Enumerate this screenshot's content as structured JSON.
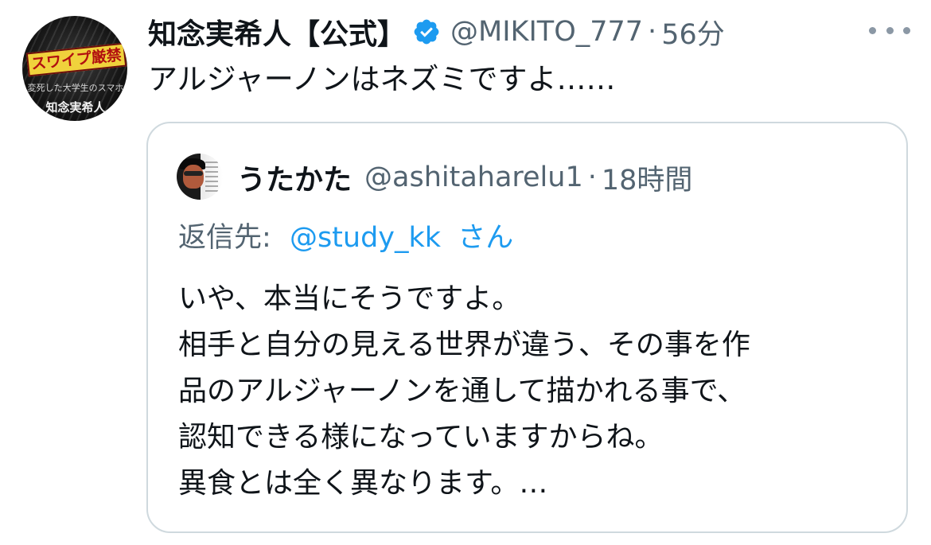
{
  "tweet": {
    "author": {
      "display_name": "知念実希人【公式】",
      "handle": "@MIKITO_777",
      "verified": true,
      "avatar": {
        "banner_text": "スワイプ厳禁",
        "sub_text": "変死した大学生のスマホ",
        "name_text": "知念実希人"
      }
    },
    "separator": "·",
    "time": "56分",
    "text": "アルジャーノンはネズミですよ……",
    "more_icon": "more-horizontal-icon"
  },
  "quoted": {
    "author": {
      "display_name": "うたかた",
      "handle": "@ashitaharelu1"
    },
    "separator": "·",
    "time": "18時間",
    "reply_to": {
      "label": "返信先:",
      "handle": "@study_kk",
      "suffix": "さん"
    },
    "lines": [
      "いや、本当にそうですよ。",
      "相手と自分の見える世界が違う、その事を作",
      "品のアルジャーノンを通して描かれる事で、",
      "認知できる様になっていますからね。",
      "異食とは全く異なります。…"
    ]
  },
  "colors": {
    "text_primary": "#0f1419",
    "text_secondary": "#536471",
    "link": "#1d9bf0",
    "verified_badge": "#1d9bf0",
    "border": "#cfd9de"
  }
}
